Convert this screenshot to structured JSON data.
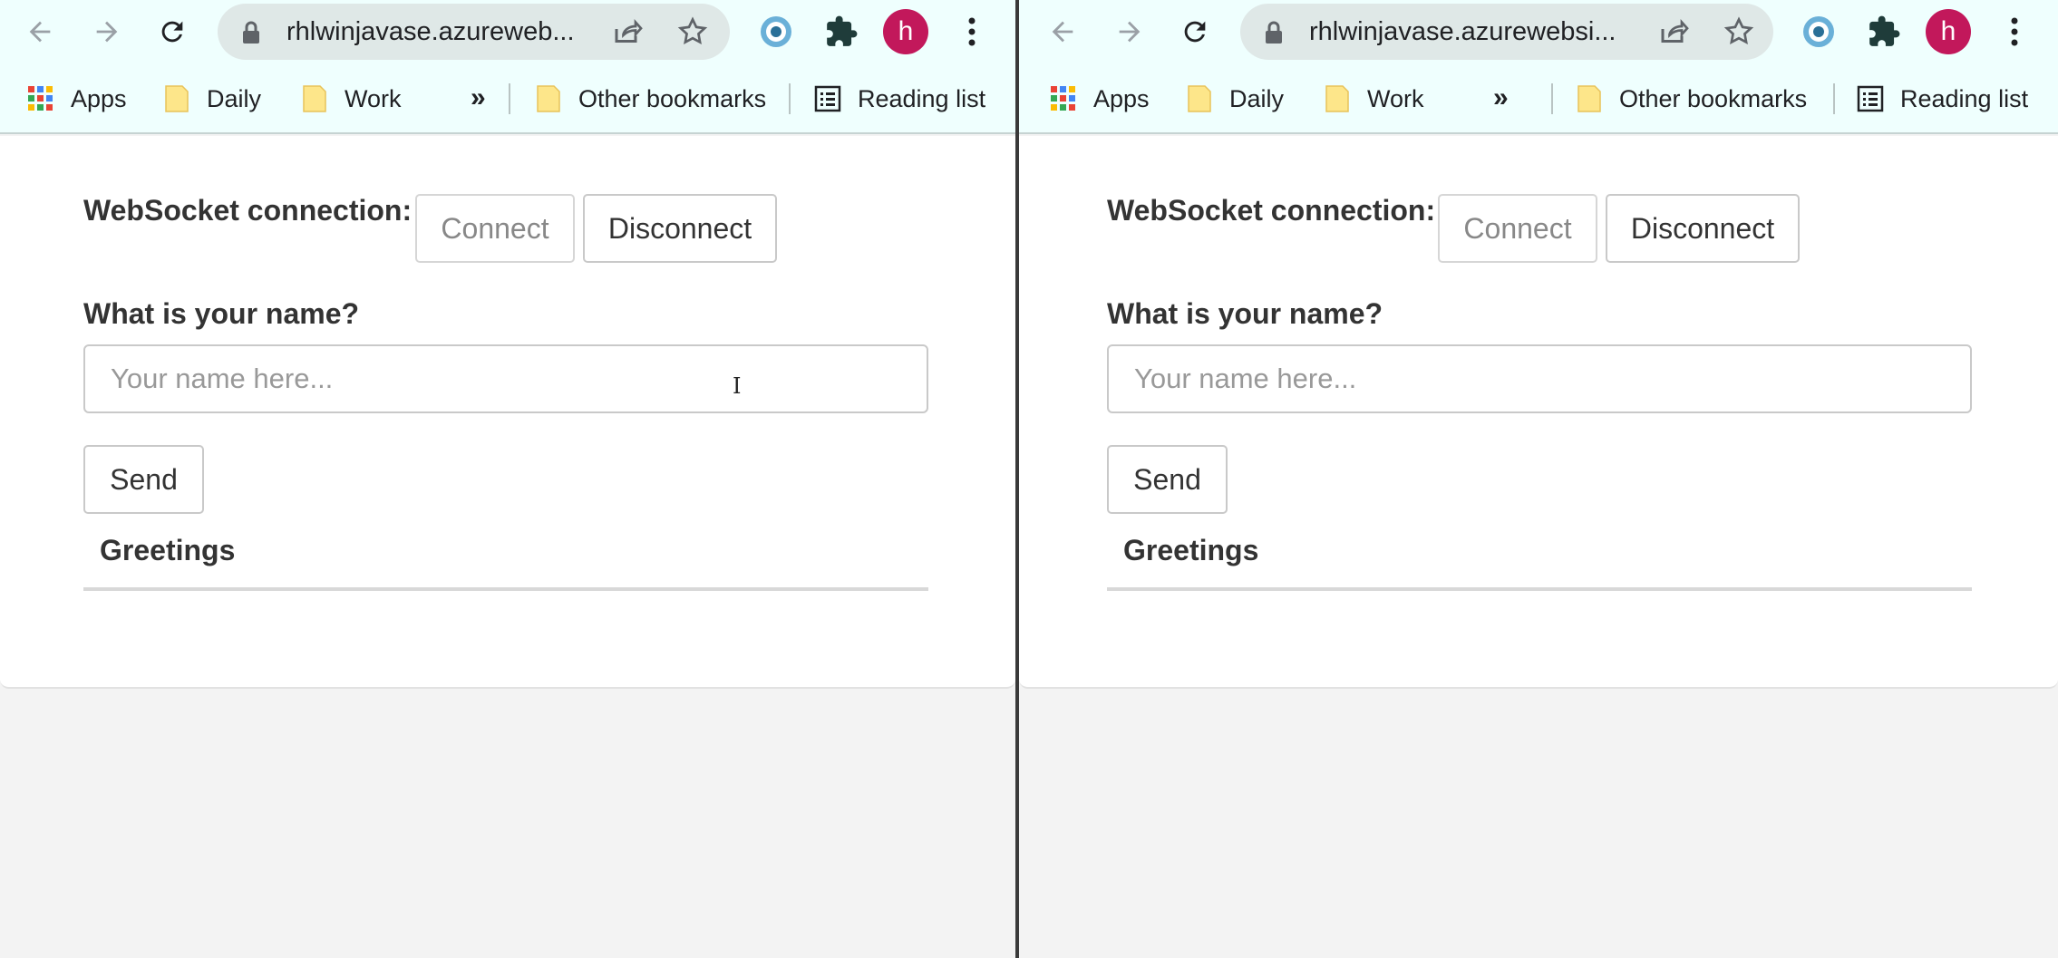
{
  "windows": {
    "left": {
      "url": "rhlwinjavase.azureweb...",
      "profile_initial": "h"
    },
    "right": {
      "url": "rhlwinjavase.azurewebsi...",
      "profile_initial": "h"
    }
  },
  "bookmarks": {
    "apps": "Apps",
    "daily": "Daily",
    "work": "Work",
    "overflow": "»",
    "other": "Other bookmarks",
    "reading_list": "Reading list"
  },
  "page": {
    "ws_label": "WebSocket connection:",
    "connect": "Connect",
    "disconnect": "Disconnect",
    "name_label": "What is your name?",
    "name_placeholder": "Your name here...",
    "send": "Send",
    "greetings_header": "Greetings"
  },
  "colors": {
    "toolbar_bg": "#effffe",
    "avatar": "#c2185b",
    "page_bg": "#ffffff"
  }
}
